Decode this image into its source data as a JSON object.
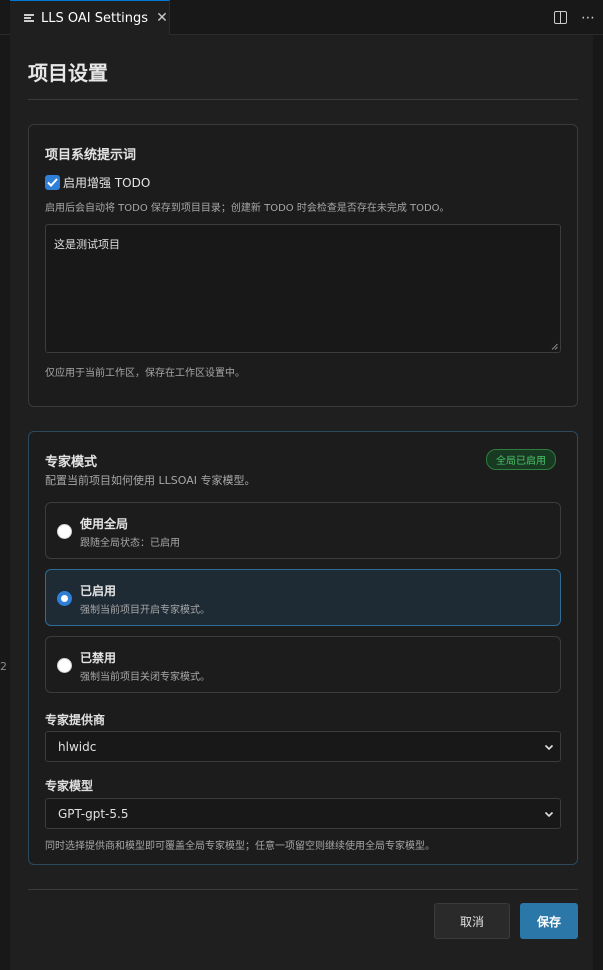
{
  "tab": {
    "title": "LLS OAI Settings",
    "close": "✕",
    "more": "⋯"
  },
  "gutter": {
    "line": "2"
  },
  "page": {
    "title": "项目设置"
  },
  "prompt_card": {
    "title": "项目系统提示词",
    "checkbox_label": "启用增强 TODO",
    "checkbox_checked": true,
    "checkbox_hint": "启用后会自动将 TODO 保存到项目目录；创建新 TODO 时会检查是否存在未完成 TODO。",
    "textarea_value": "这是测试项目",
    "footer_hint": "仅应用于当前工作区，保存在工作区设置中。"
  },
  "expert_card": {
    "title": "专家模式",
    "subtitle": "配置当前项目如何使用 LLSOAI 专家模型。",
    "badge": "全局已启用",
    "options": [
      {
        "title": "使用全局",
        "desc": "跟随全局状态：已启用",
        "selected": false
      },
      {
        "title": "已启用",
        "desc": "强制当前项目开启专家模式。",
        "selected": true
      },
      {
        "title": "已禁用",
        "desc": "强制当前项目关闭专家模式。",
        "selected": false
      }
    ],
    "provider_label": "专家提供商",
    "provider_value": "hlwidc",
    "model_label": "专家模型",
    "model_value": "GPT-gpt-5.5",
    "footer_hint": "同时选择提供商和模型即可覆盖全局专家模型；任意一项留空则继续使用全局专家模型。"
  },
  "actions": {
    "cancel": "取消",
    "save": "保存"
  },
  "colors": {
    "accent": "#2b78a8",
    "checkbox": "#2f7fd6",
    "badge_green": "#4ec26a",
    "tab_border": "#0078d4"
  }
}
